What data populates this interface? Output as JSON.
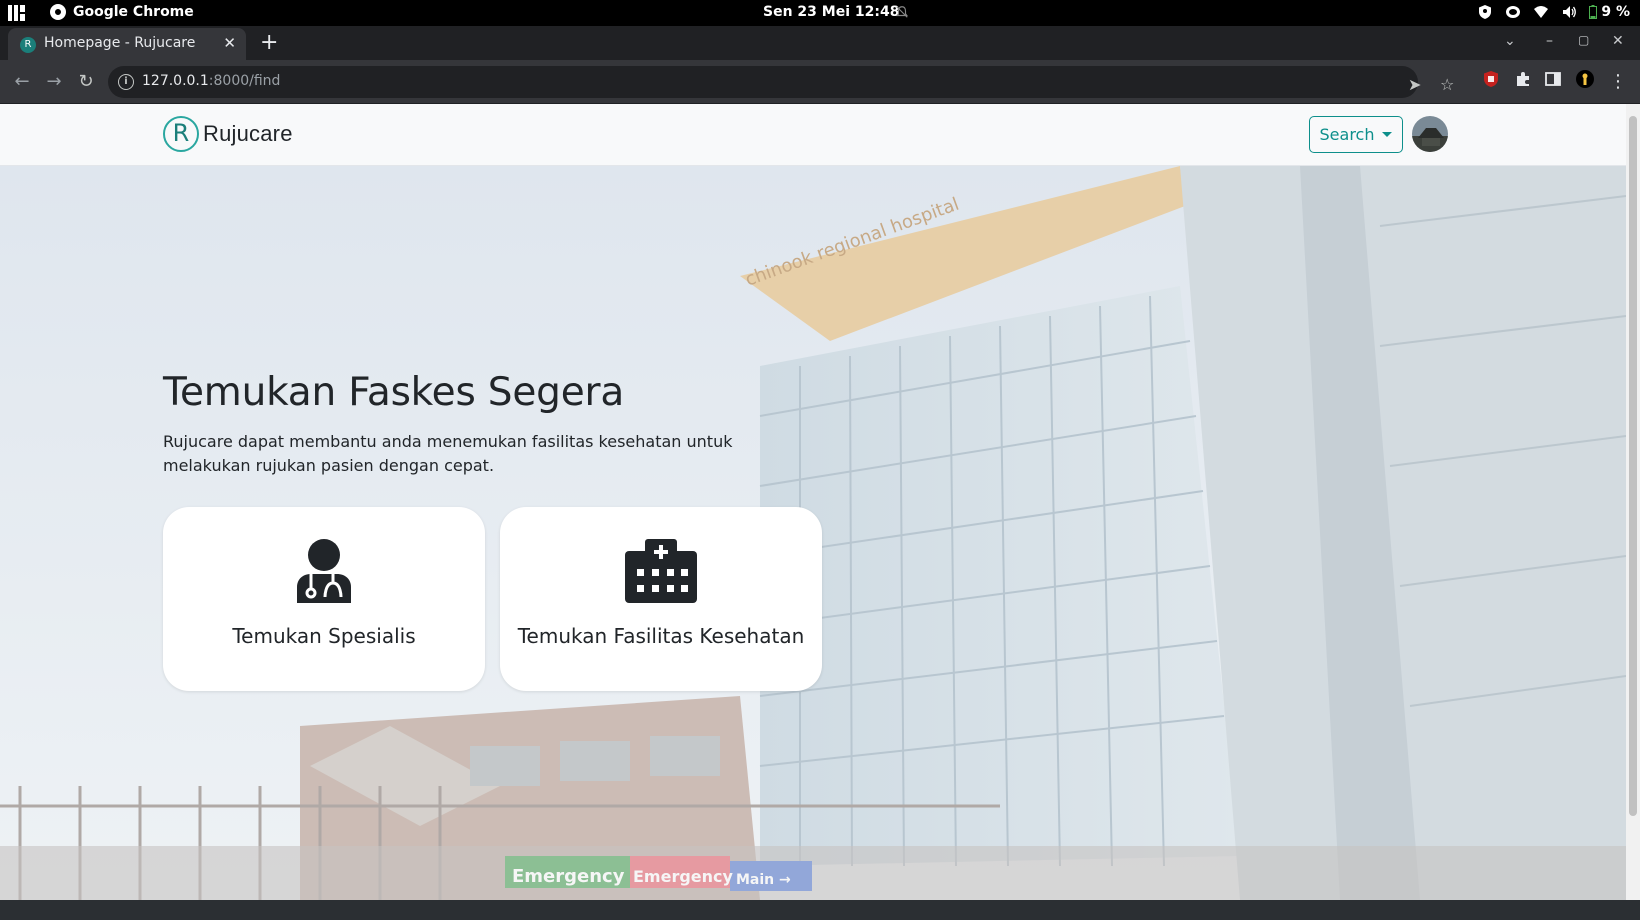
{
  "os_bar": {
    "app_name": "Google Chrome",
    "clock": "Sen 23 Mei  12:48",
    "battery": "9 %"
  },
  "browser": {
    "tab_title": "Homepage - Rujucare",
    "url_host": "127.0.0.1",
    "url_path": ":8000/find"
  },
  "site": {
    "brand_name": "Rujucare",
    "brand_letter": "R",
    "search_label": "Search",
    "accent_color": "#0d8f8b"
  },
  "hero": {
    "title": "Temukan Faskes Segera",
    "description": "Rujucare dapat membantu anda menemukan fasilitas kesehatan untuk melakukan rujukan pasien dengan cepat."
  },
  "cards": [
    {
      "label": "Temukan Spesialis",
      "icon": "doctor-icon"
    },
    {
      "label": "Temukan Fasilitas Kesehatan",
      "icon": "hospital-icon"
    }
  ],
  "background_signs": {
    "sign_1": "chinook regional hospital",
    "sign_2": "Emergency",
    "sign_3": "Emergency",
    "sign_4": "Main →"
  }
}
